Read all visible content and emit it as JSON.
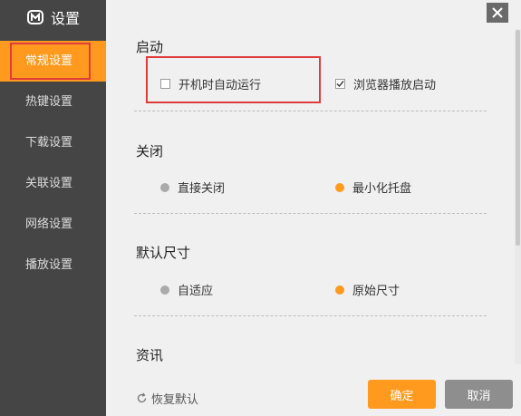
{
  "app": {
    "title": "设置"
  },
  "sidebar": {
    "items": [
      {
        "label": "常规设置",
        "active": true
      },
      {
        "label": "热键设置"
      },
      {
        "label": "下载设置"
      },
      {
        "label": "关联设置"
      },
      {
        "label": "网络设置"
      },
      {
        "label": "播放设置"
      }
    ]
  },
  "sections": {
    "startup": {
      "title": "启动",
      "option1": {
        "label": "开机时自动运行",
        "checked": false
      },
      "option2": {
        "label": "浏览器播放启动",
        "checked": true
      }
    },
    "close": {
      "title": "关闭",
      "option1": {
        "label": "直接关闭",
        "selected": false
      },
      "option2": {
        "label": "最小化托盘",
        "selected": true
      }
    },
    "size": {
      "title": "默认尺寸",
      "option1": {
        "label": "自适应",
        "selected": false
      },
      "option2": {
        "label": "原始尺寸",
        "selected": true
      }
    },
    "news": {
      "title": "资讯"
    }
  },
  "footer": {
    "restore_label": "恢复默认",
    "ok_label": "确定",
    "cancel_label": "取消"
  },
  "colors": {
    "accent": "#ff9a1f",
    "sidebar": "#454545",
    "highlight_box": "#e13c3c"
  }
}
